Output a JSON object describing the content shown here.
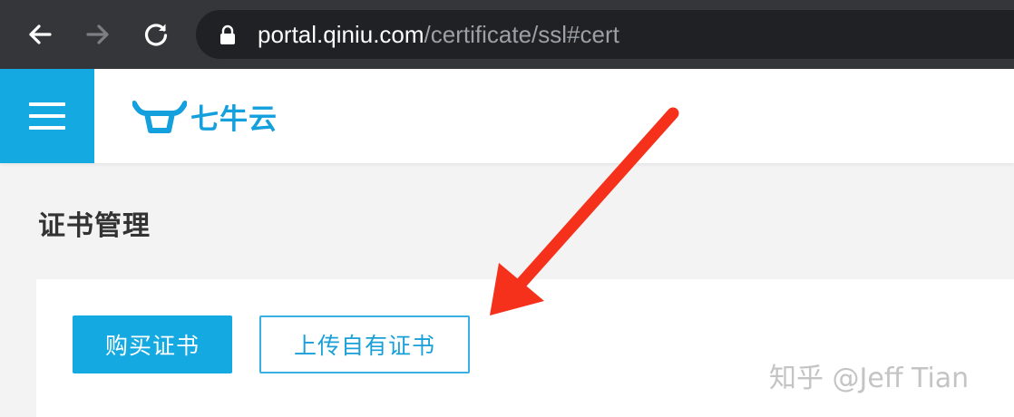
{
  "browser": {
    "icons": {
      "back": "arrow-left-icon",
      "forward": "arrow-right-icon",
      "reload": "reload-icon",
      "lock": "lock-icon"
    },
    "url_host": "portal.qiniu.com",
    "url_path": "/certificate/ssl#cert"
  },
  "header": {
    "menu_icon": "hamburger-menu-icon",
    "logo_text": "七牛云",
    "accent_color": "#14a9e0"
  },
  "page": {
    "title": "证书管理"
  },
  "actions": {
    "buy_label": "购买证书",
    "upload_label": "上传自有证书"
  },
  "annotation": {
    "arrow_color": "#f5311c"
  },
  "watermark": "知乎 @Jeff Tian"
}
